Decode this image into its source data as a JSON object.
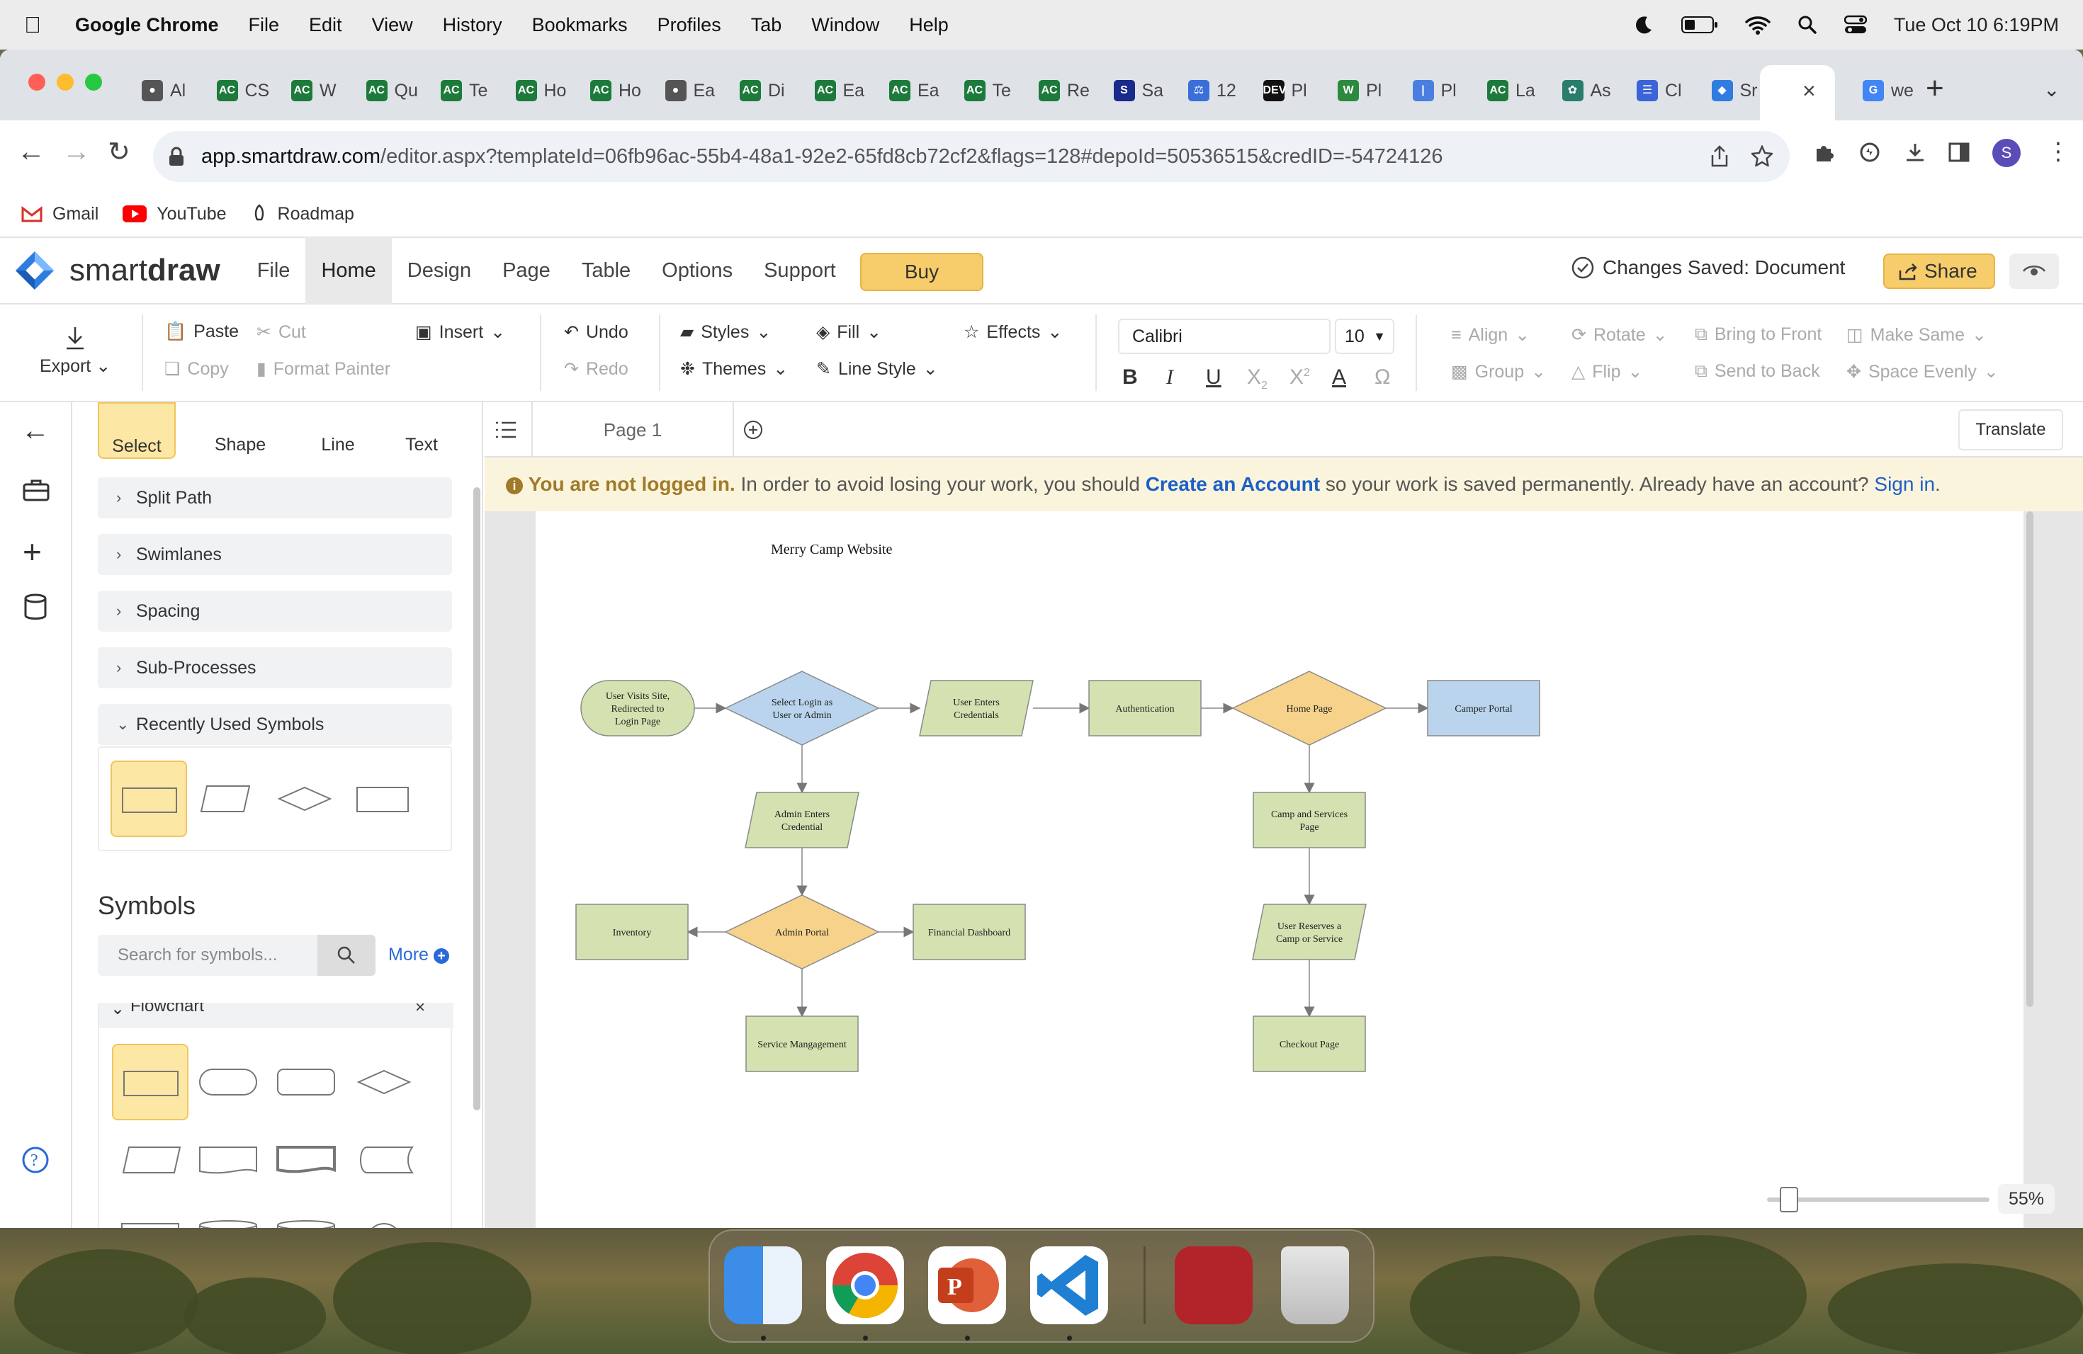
{
  "os": {
    "menu": [
      "Google Chrome",
      "File",
      "Edit",
      "View",
      "History",
      "Bookmarks",
      "Profiles",
      "Tab",
      "Window",
      "Help"
    ],
    "datetime": "Tue Oct 10  6:19PM"
  },
  "browser": {
    "tabs": [
      "Al",
      "CS",
      "W",
      "Qu",
      "Te",
      "Ho",
      "Ho",
      "Ea",
      "Di",
      "Ea",
      "Ea",
      "Te",
      "Re",
      "Sa",
      "12",
      "Pl",
      "Pl",
      "Pl",
      "La",
      "As",
      "Cl",
      "Sr",
      "we"
    ],
    "url_host": "app.smartdraw.com",
    "url_rest": "/editor.aspx?templateId=06fb96ac-55b4-48a1-92e2-65fd8cb72cf2&flags=128#depoId=50536515&credID=-54724126",
    "profile_initial": "S",
    "bookmarks": [
      "Gmail",
      "YouTube",
      "Roadmap"
    ]
  },
  "app": {
    "brand_smart": "smart",
    "brand_draw": "draw",
    "menu": [
      "File",
      "Home",
      "Design",
      "Page",
      "Table",
      "Options",
      "Support"
    ],
    "active_menu": "Home",
    "buy": "Buy",
    "status": "Changes Saved: Document",
    "share": "Share"
  },
  "ribbon": {
    "export": "Export",
    "paste": "Paste",
    "cut": "Cut",
    "copy": "Copy",
    "format_painter": "Format Painter",
    "insert": "Insert",
    "undo": "Undo",
    "redo": "Redo",
    "styles": "Styles",
    "themes": "Themes",
    "fill": "Fill",
    "line_style": "Line Style",
    "effects": "Effects",
    "font": "Calibri",
    "size": "10",
    "align": "Align",
    "group": "Group",
    "rotate": "Rotate",
    "flip": "Flip",
    "bring_front": "Bring to Front",
    "send_back": "Send to Back",
    "make_same": "Make Same",
    "space_evenly": "Space Evenly"
  },
  "panel": {
    "tools": [
      "Select",
      "Shape",
      "Line",
      "Text"
    ],
    "sections": [
      "Split Path",
      "Swimlanes",
      "Spacing",
      "Sub-Processes",
      "Recently Used Symbols"
    ],
    "symbols_title": "Symbols",
    "search_placeholder": "Search for symbols...",
    "more": "More",
    "library": "Flowchart"
  },
  "canvas": {
    "page_tab": "Page 1",
    "translate": "Translate",
    "notice_bold": "You are not logged in.",
    "notice_1": " In order to avoid losing your work, you should ",
    "notice_link1": "Create an Account",
    "notice_2": " so your work is saved permanently. Already have an account? ",
    "notice_link2": "Sign in",
    "notice_end": ".",
    "zoom": "55%"
  },
  "diagram": {
    "title": "Merry Camp Website",
    "colors": {
      "green": "#d3e2b0",
      "blue": "#b9d4ec",
      "orange": "#f6d28a",
      "stroke": "#8a8a8a"
    },
    "nodes": {
      "visit": [
        "User Visits Site,",
        "Redirected to",
        "Login Page"
      ],
      "select": [
        "Select Login as",
        "User or Admin"
      ],
      "user_cred": [
        "User Enters",
        "Credentials"
      ],
      "auth": [
        "Authentication"
      ],
      "home": [
        "Home Page"
      ],
      "camper": [
        "Camper Portal"
      ],
      "admin_cred": [
        "Admin Enters",
        "Credential"
      ],
      "camp_services": [
        "Camp and Services",
        "Page"
      ],
      "inventory": [
        "Inventory"
      ],
      "admin_portal": [
        "Admin Portal"
      ],
      "financial": [
        "Financial Dashboard"
      ],
      "reserves": [
        "User Reserves a",
        "Camp or Service"
      ],
      "service_mgmt": [
        "Service Mangagement"
      ],
      "checkout": [
        "Checkout Page"
      ]
    }
  }
}
